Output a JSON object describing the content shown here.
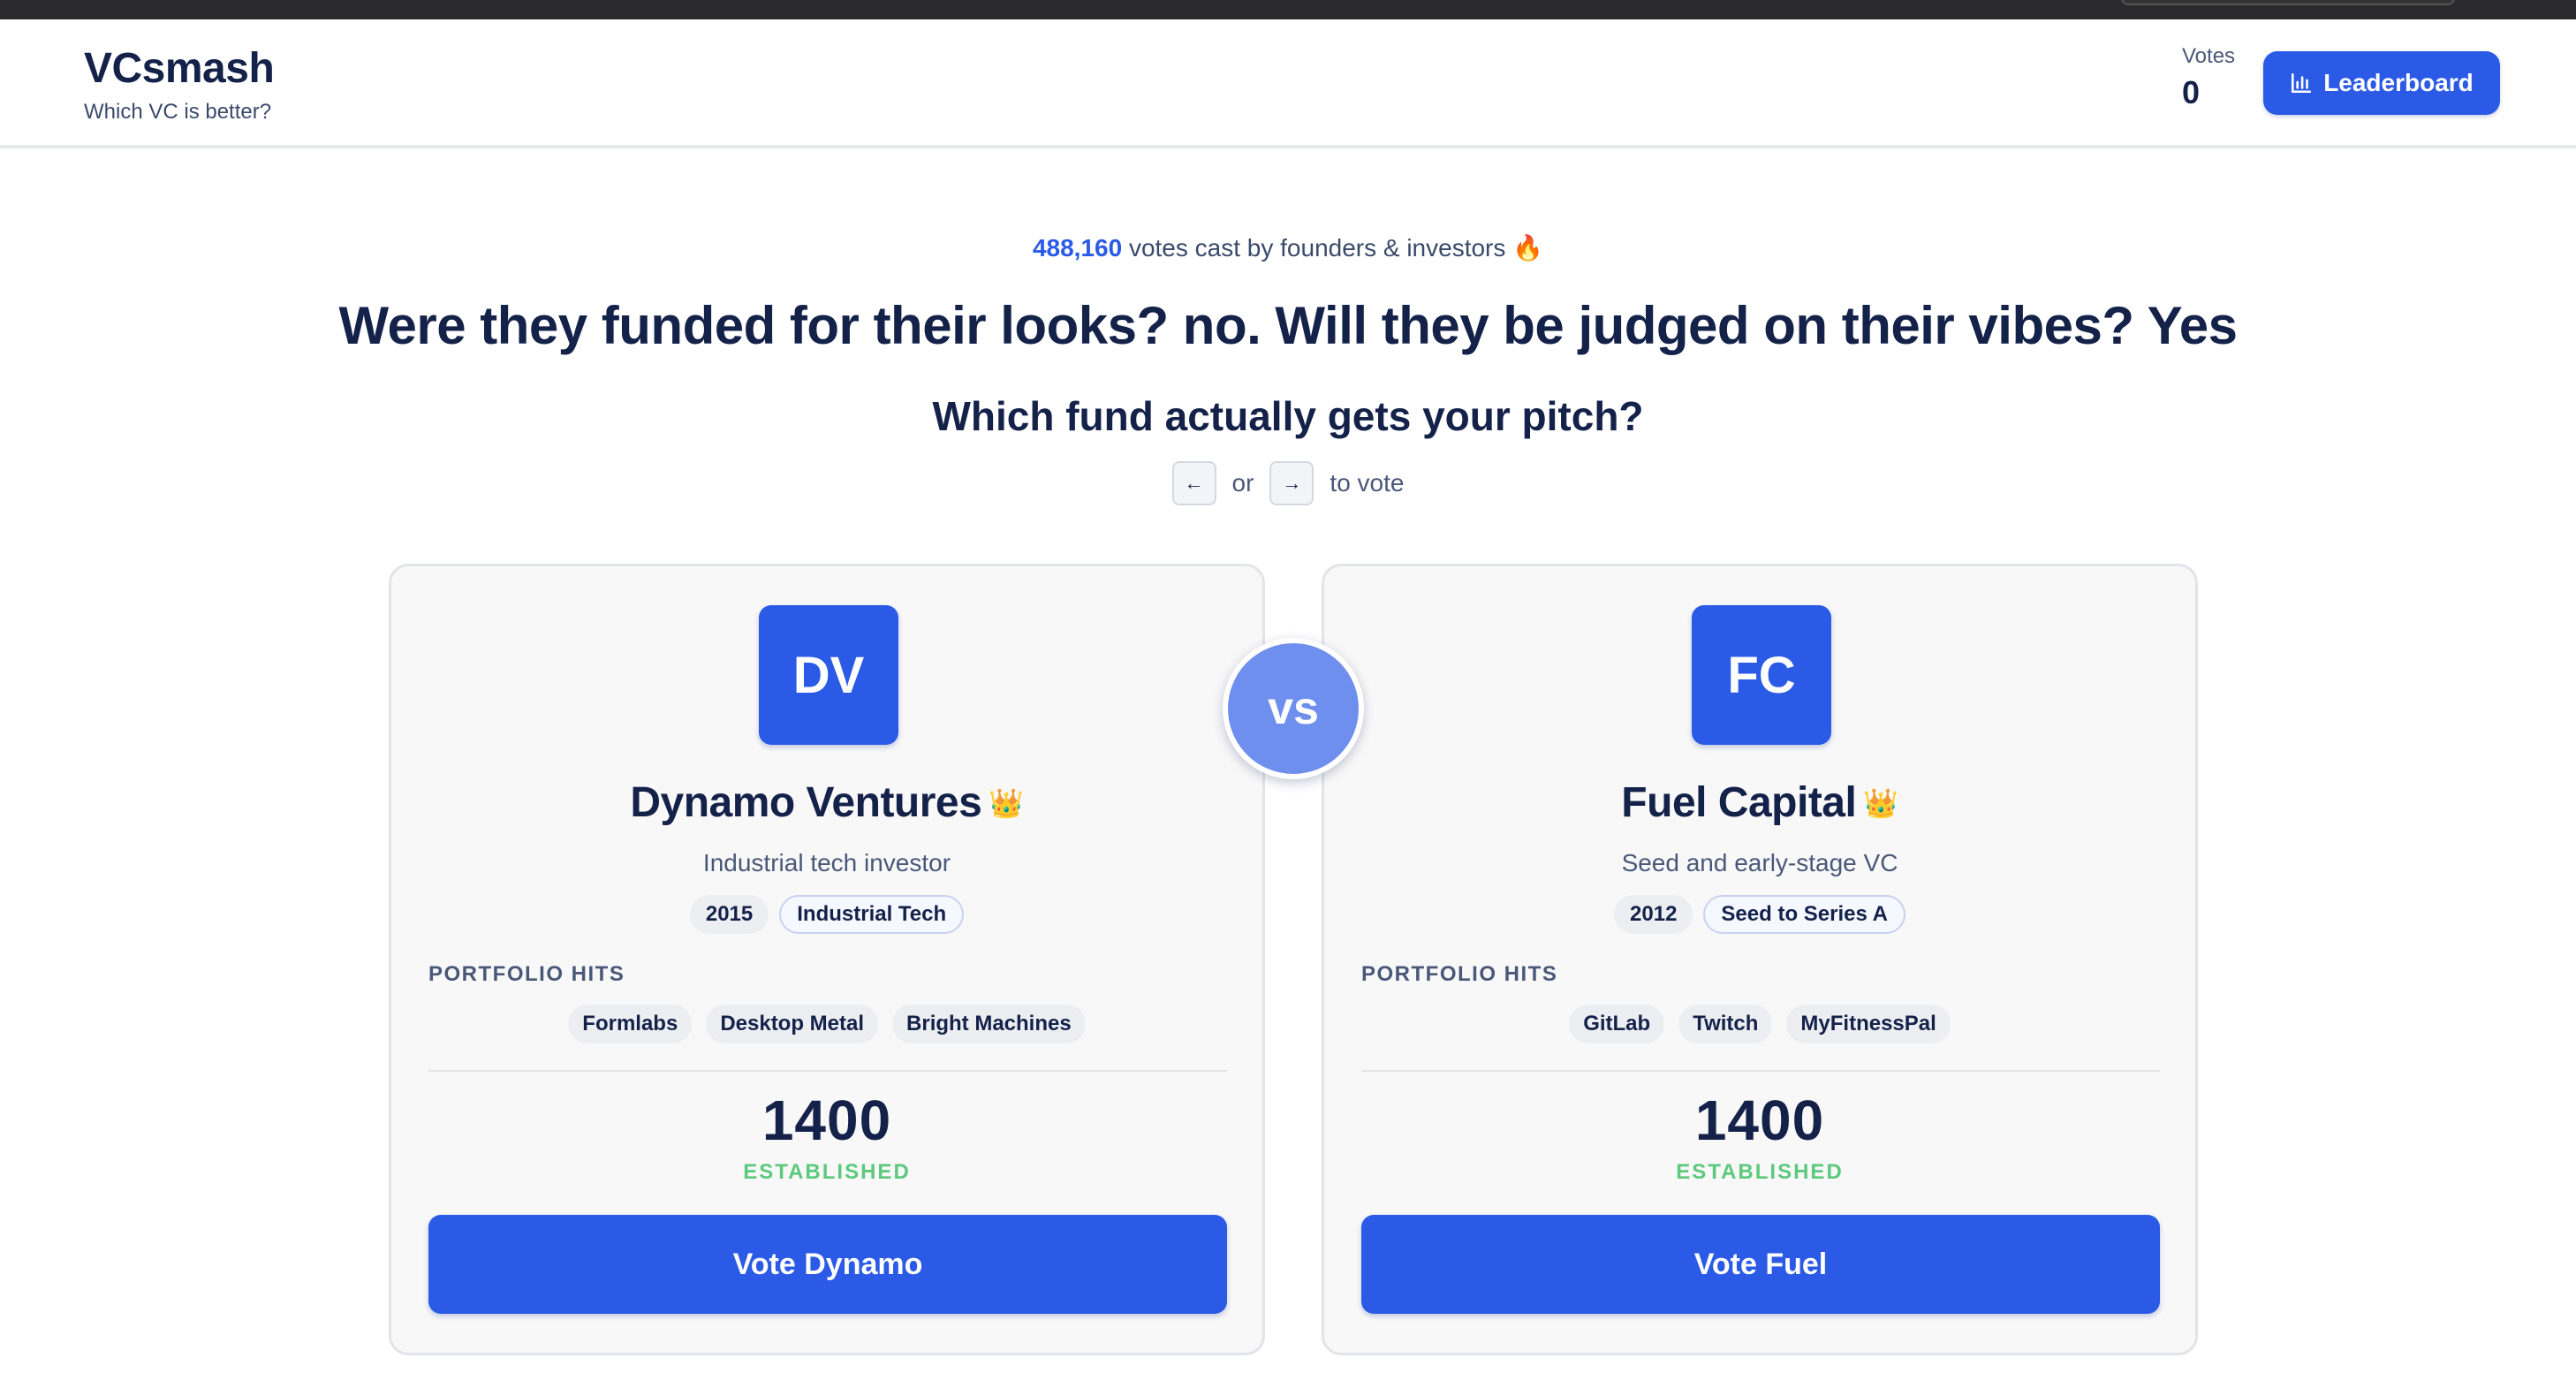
{
  "brand": {
    "name": "VCsmash",
    "tagline": "Which VC is better?"
  },
  "header": {
    "votes_label": "Votes",
    "votes_count": "0",
    "leaderboard_label": "Leaderboard"
  },
  "stats": {
    "votes_total": "488,160",
    "votes_suffix": "votes cast by founders & investors",
    "emoji": "🔥"
  },
  "headline": "Were they funded for their looks? no. Will they be judged on their vibes? Yes",
  "subhead": "Which fund actually gets your pitch?",
  "keyhint": {
    "left_key": "←",
    "or": "or",
    "right_key": "→",
    "suffix": "to vote"
  },
  "vs": "vs",
  "cards": [
    {
      "initials": "DV",
      "name": "Dynamo Ventures",
      "crown": "👑",
      "description": "Industrial tech investor",
      "year": "2015",
      "stage": "Industrial Tech",
      "portfolio_label": "PORTFOLIO HITS",
      "hits": [
        "Formlabs",
        "Desktop Metal",
        "Bright Machines"
      ],
      "rating": "1400",
      "status": "ESTABLISHED",
      "vote_label": "Vote Dynamo"
    },
    {
      "initials": "FC",
      "name": "Fuel Capital",
      "crown": "👑",
      "description": "Seed and early-stage VC",
      "year": "2012",
      "stage": "Seed to Series A",
      "portfolio_label": "PORTFOLIO HITS",
      "hits": [
        "GitLab",
        "Twitch",
        "MyFitnessPal"
      ],
      "rating": "1400",
      "status": "ESTABLISHED",
      "vote_label": "Vote Fuel"
    }
  ],
  "colors": {
    "accent": "#2a5ae6",
    "status_green": "#5cc97d",
    "text_dark": "#14224a"
  },
  "icons": {
    "leaderboard": "bar-chart-icon",
    "status": "fire-icon",
    "winner": "crown-icon"
  }
}
